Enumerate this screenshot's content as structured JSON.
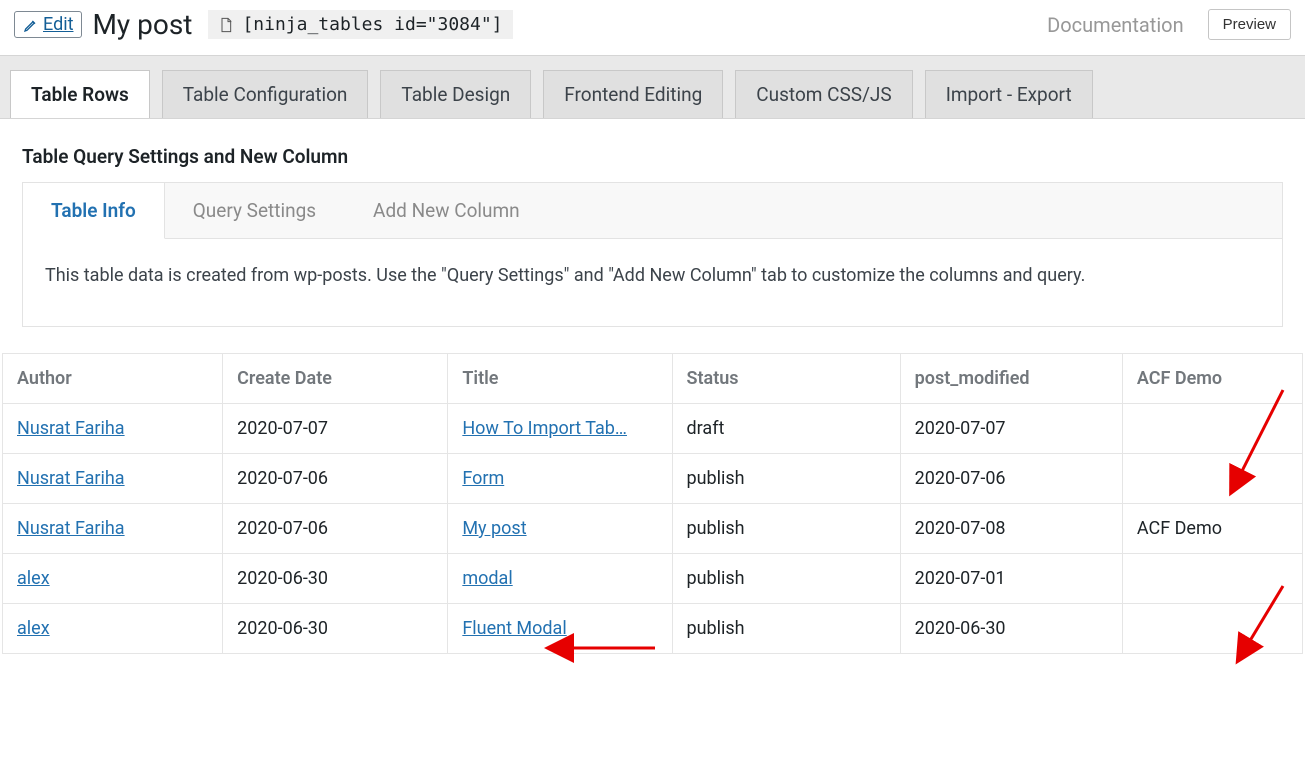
{
  "header": {
    "edit_label": "Edit",
    "title": "My post",
    "shortcode": "[ninja_tables id=\"3084\"]",
    "documentation_label": "Documentation",
    "preview_label": "Preview"
  },
  "main_tabs": [
    {
      "label": "Table Rows",
      "active": true
    },
    {
      "label": "Table Configuration",
      "active": false
    },
    {
      "label": "Table Design",
      "active": false
    },
    {
      "label": "Frontend Editing",
      "active": false
    },
    {
      "label": "Custom CSS/JS",
      "active": false
    },
    {
      "label": "Import - Export",
      "active": false
    }
  ],
  "section_heading": "Table Query Settings and New Column",
  "inner_tabs": [
    {
      "label": "Table Info",
      "active": true
    },
    {
      "label": "Query Settings",
      "active": false
    },
    {
      "label": "Add New Column",
      "active": false
    }
  ],
  "panel_text": "This table data is created from wp-posts. Use the \"Query Settings\" and \"Add New Column\" tab to customize the columns and query.",
  "table": {
    "columns": [
      "Author",
      "Create Date",
      "Title",
      "Status",
      "post_modified",
      "ACF Demo"
    ],
    "rows": [
      {
        "author": "Nusrat Fariha",
        "create_date": "2020-07-07",
        "title": "How To Import Tab…",
        "status": "draft",
        "post_modified": "2020-07-07",
        "acf_demo": ""
      },
      {
        "author": "Nusrat Fariha",
        "create_date": "2020-07-06",
        "title": "Form",
        "status": "publish",
        "post_modified": "2020-07-06",
        "acf_demo": ""
      },
      {
        "author": "Nusrat Fariha",
        "create_date": "2020-07-06",
        "title": "My post",
        "status": "publish",
        "post_modified": "2020-07-08",
        "acf_demo": "ACF Demo"
      },
      {
        "author": "alex",
        "create_date": "2020-06-30",
        "title": "modal",
        "status": "publish",
        "post_modified": "2020-07-01",
        "acf_demo": ""
      },
      {
        "author": "alex",
        "create_date": "2020-06-30",
        "title": "Fluent Modal",
        "status": "publish",
        "post_modified": "2020-06-30",
        "acf_demo": ""
      }
    ]
  },
  "annotation_color": "#e60000"
}
